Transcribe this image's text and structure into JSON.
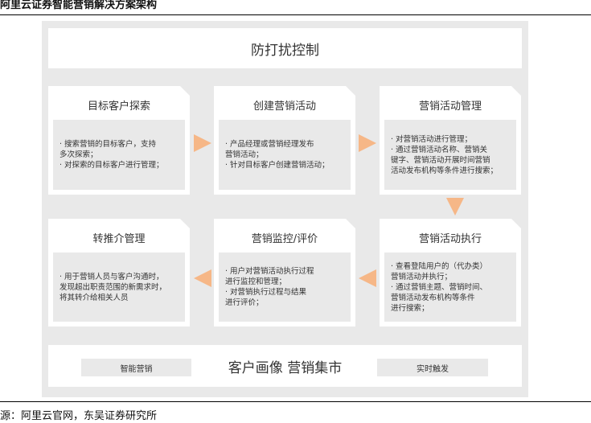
{
  "header": {
    "title": "阿里云证券智能营销解决方案架构"
  },
  "footer": {
    "source": "源：阿里云官网，东吴证券研究所"
  },
  "top_banner": {
    "label": "防打扰控制"
  },
  "cards": [
    {
      "title": "目标客户探索",
      "lines": [
        "· 搜索营销的目标客户，支持",
        "多次探索；",
        "· 对探索的目标客户进行管理；"
      ]
    },
    {
      "title": "创建营销活动",
      "lines": [
        "· 产品经理或营销经理发布",
        "营销活动；",
        "· 针对目标客户创建营销活动；"
      ]
    },
    {
      "title": "营销活动管理",
      "lines": [
        "· 对营销活动进行管理；",
        "· 通过营销活动名称、营销关",
        "键字、营销活动开展时间营销",
        "活动发布机构等条件进行搜索；"
      ]
    },
    {
      "title": "转推介管理",
      "lines": [
        "· 用于营销人员与客户沟通时，",
        "发现超出职责范围的新需求时，",
        "将其转介给相关人员"
      ]
    },
    {
      "title": "营销监控/评价",
      "lines": [
        "· 用户对营销活动执行过程",
        "进行监控和管理；",
        "· 对营销执行过程与结果",
        "进行评价；"
      ]
    },
    {
      "title": "营销活动执行",
      "lines": [
        "· 查看登陆用户的（代办类）",
        "营销活动并执行；",
        "· 通过营销主题、营销时间、",
        "营销活动发布机构等条件",
        "进行搜索；"
      ]
    }
  ],
  "bottom_banner": {
    "left_label": "智能营销",
    "center_label": "客户画像 营销集市",
    "right_label": "实时触发"
  }
}
